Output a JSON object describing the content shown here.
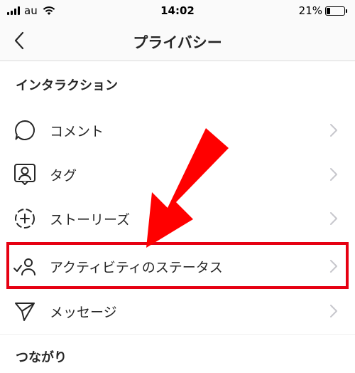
{
  "status_bar": {
    "carrier": "au",
    "time": "14:02",
    "battery_percent": "21%",
    "battery_level": 0.21
  },
  "nav": {
    "title": "プライバシー",
    "back_icon": "chevron-left-icon"
  },
  "sections": [
    {
      "header": "インタラクション",
      "items": [
        {
          "label": "コメント",
          "icon": "comment-bubble-icon"
        },
        {
          "label": "タグ",
          "icon": "tag-person-icon"
        },
        {
          "label": "ストーリーズ",
          "icon": "story-add-icon"
        },
        {
          "label": "アクティビティのステータス",
          "icon": "activity-status-icon"
        },
        {
          "label": "メッセージ",
          "icon": "paper-plane-icon"
        }
      ]
    },
    {
      "header": "つながり"
    }
  ],
  "annotation": {
    "highlight_color": "#e60012",
    "arrow_color": "#ff0000"
  }
}
